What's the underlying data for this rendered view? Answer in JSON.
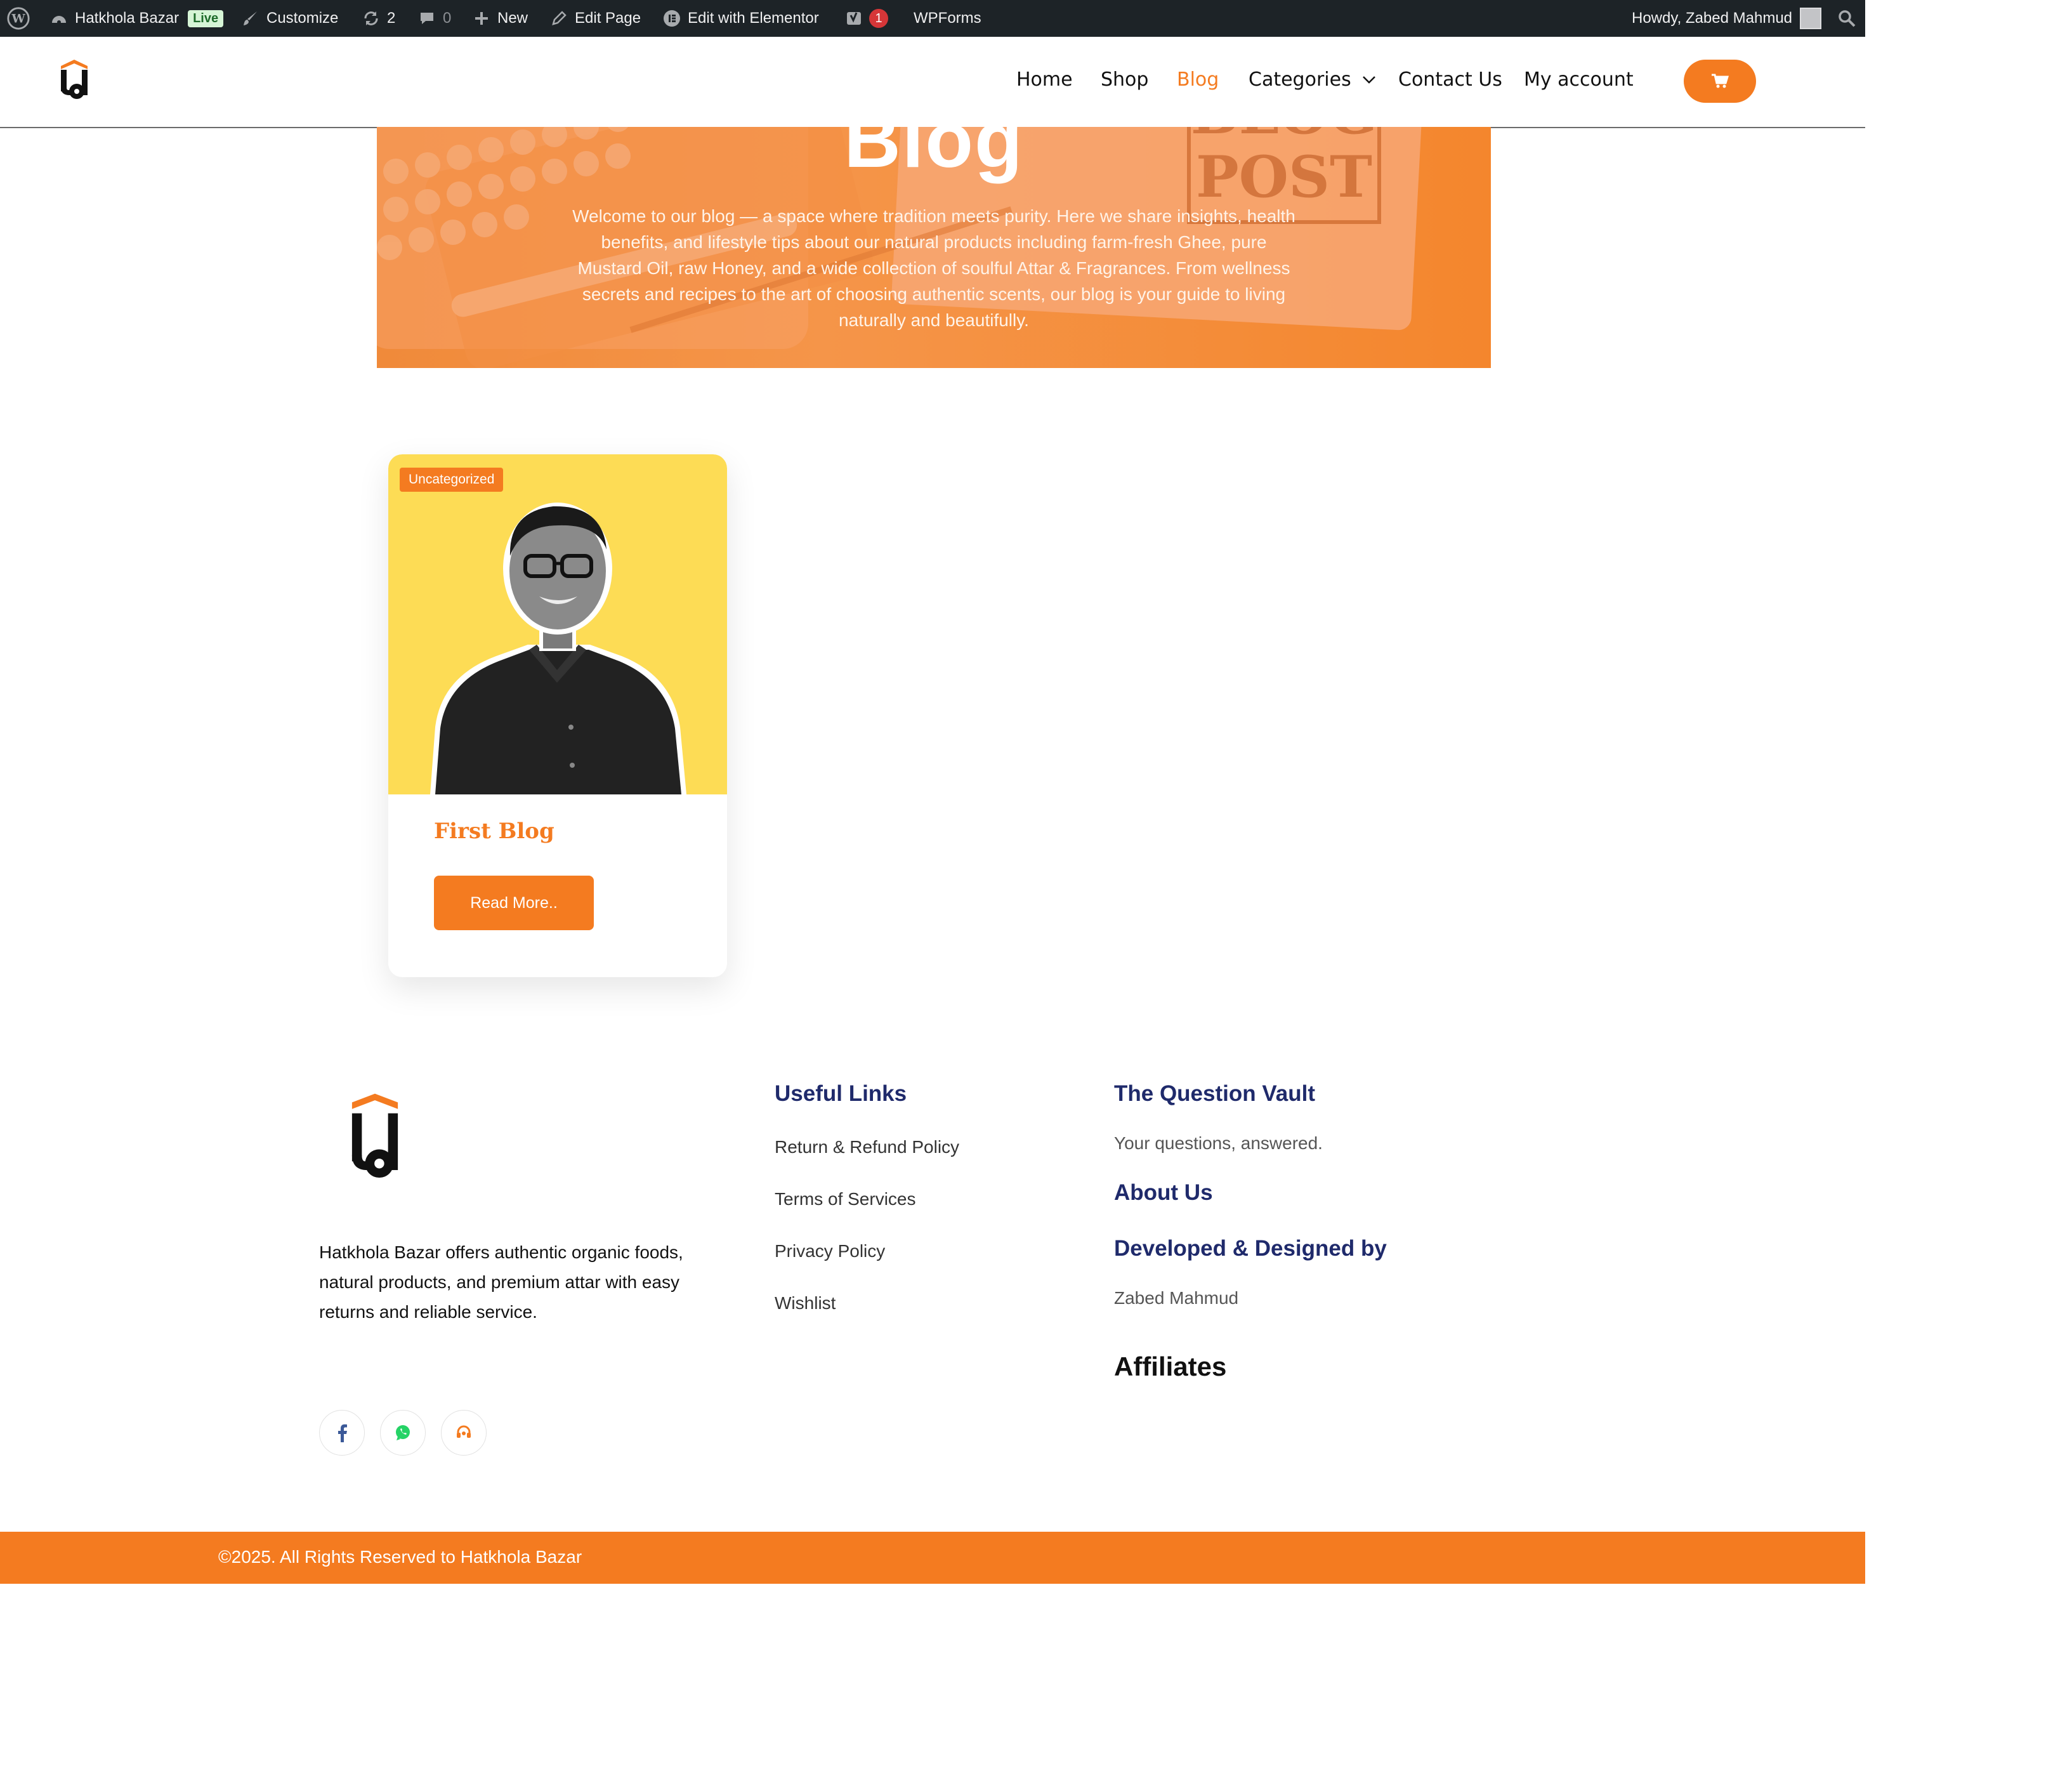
{
  "admin_bar": {
    "site_name": "Hatkhola Bazar",
    "live_badge": "Live",
    "customize": "Customize",
    "updates_count": "2",
    "comments_count": "0",
    "new": "New",
    "edit_page": "Edit Page",
    "edit_elementor": "Edit with Elementor",
    "yoast_count": "1",
    "wpforms": "WPForms",
    "howdy": "Howdy, Zabed Mahmud"
  },
  "nav": {
    "items": [
      {
        "label": "Home"
      },
      {
        "label": "Shop"
      },
      {
        "label": "Blog",
        "active": true
      },
      {
        "label": "Categories"
      },
      {
        "label": "Contact Us"
      },
      {
        "label": "My account"
      }
    ]
  },
  "hero": {
    "title": "Blog",
    "description": "Welcome to our blog — a space where tradition meets purity. Here we share insights, health benefits, and lifestyle tips about our natural products including farm-fresh Ghee, pure Mustard Oil, raw Honey, and a wide collection of soulful Attar & Fragrances. From wellness secrets and recipes to the art of choosing authentic scents, our blog is your guide to living naturally and beautifully."
  },
  "post": {
    "category": "Uncategorized",
    "title": "First Blog",
    "read_more": "Read More.."
  },
  "footer": {
    "about": "Hatkhola Bazar offers authentic organic foods, natural products, and premium attar with easy returns and reliable service.",
    "useful_links_title": "Useful Links",
    "useful_links": [
      "Return & Refund Policy",
      "Terms of Services",
      "Privacy Policy",
      "Wishlist"
    ],
    "question_vault_title": "The Question Vault",
    "question_vault_sub": "Your questions, answered.",
    "about_us_title": "About Us",
    "developed_title": "Developed & Designed by",
    "developer": "Zabed Mahmud",
    "affiliates_title": "Affiliates",
    "copyright": "©2025. All Rights Reserved to Hatkhola Bazar"
  },
  "colors": {
    "accent": "#f47b20",
    "admin_bar": "#1d2327",
    "footer_heading": "#1f2a6b",
    "card_image_bg": "#fddc55"
  },
  "icons": [
    "wordpress-icon",
    "dashboard-icon",
    "brush-icon",
    "updates-icon",
    "comment-icon",
    "plus-icon",
    "pencil-icon",
    "elementor-icon",
    "yoast-icon",
    "search-icon",
    "cart-icon",
    "chevron-down-icon",
    "facebook-icon",
    "whatsapp-icon",
    "headset-icon"
  ]
}
